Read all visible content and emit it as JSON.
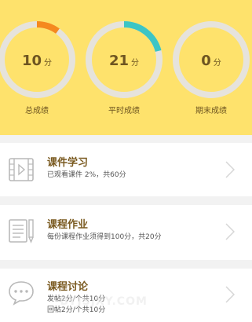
{
  "scores": [
    {
      "value": "10",
      "unit": "分",
      "label": "总成绩",
      "progress": 0.1,
      "arc_color": "#f5891f"
    },
    {
      "value": "21",
      "unit": "分",
      "label": "平时成绩",
      "progress": 0.21,
      "arc_color": "#3cc5c5"
    },
    {
      "value": "0",
      "unit": "分",
      "label": "期末成绩",
      "progress": 0,
      "arc_color": "#3cc5c5"
    }
  ],
  "colors": {
    "panel": "#fee26c",
    "ring_track": "#e6e3dc",
    "title": "#7a5a20"
  },
  "cards": [
    {
      "title": "课件学习",
      "lines": [
        "已观看课件 2%，共60分"
      ],
      "icon": "video-icon"
    },
    {
      "title": "课程作业",
      "lines": [
        "每份课程作业须得到100分，共20分"
      ],
      "icon": "homework-icon"
    },
    {
      "title": "课程讨论",
      "lines": [
        "发帖2分/个共10分",
        "回帖2分/个共10分"
      ],
      "icon": "discussion-icon"
    }
  ],
  "watermark": "·BYJSJXY.COM"
}
